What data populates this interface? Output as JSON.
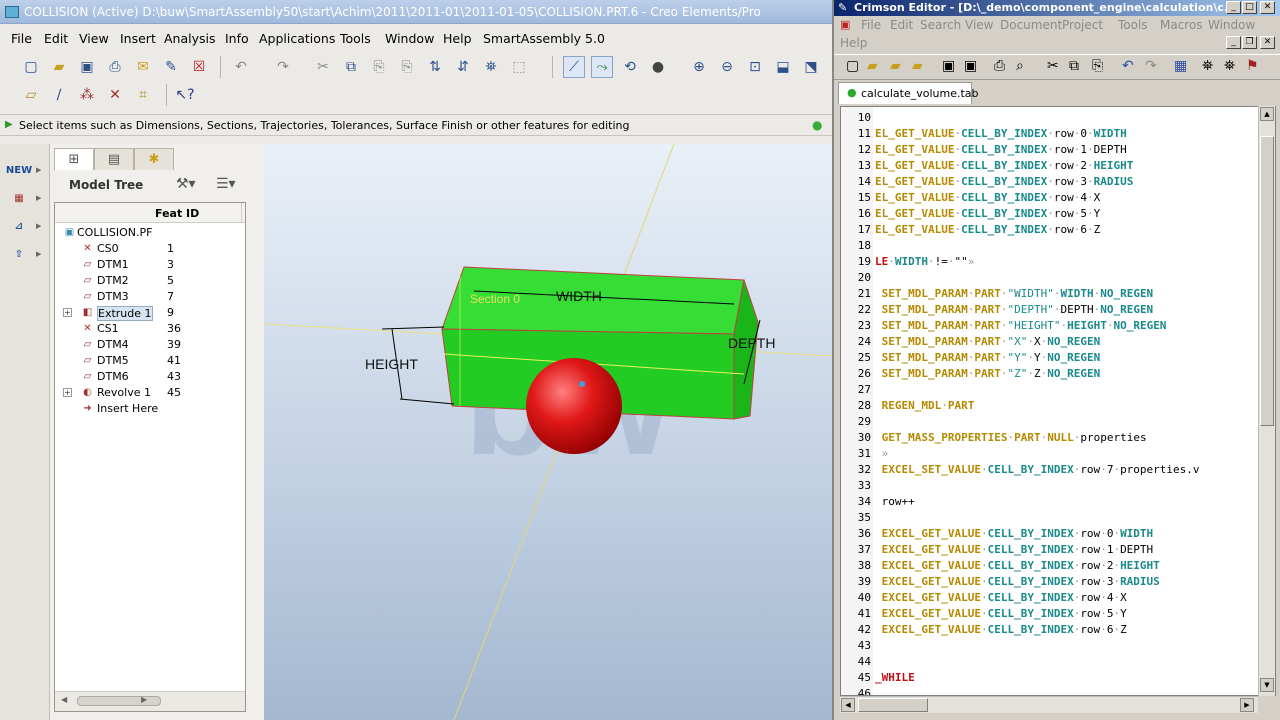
{
  "creo": {
    "title": "COLLISION (Active) D:\\buw\\SmartAssembly50\\start\\Achim\\2011\\2011-01\\2011-01-05\\COLLISION.PRT.6 - Creo Elements/Pro",
    "menu": [
      "File",
      "Edit",
      "View",
      "Insert",
      "Analysis",
      "Info",
      "Applications",
      "Tools",
      "Window",
      "Help",
      "SmartAssembly 5.0"
    ],
    "status_message": "Select items such as Dimensions, Sections, Trajectories, Tolerances, Surface Finish or other features for editing",
    "model_tree_label": "Model Tree",
    "feat_id_header": "Feat ID",
    "tree": [
      {
        "name": "COLLISION.PF",
        "id": "",
        "icon": "part-icon"
      },
      {
        "name": "CS0",
        "id": "1",
        "icon": "csys-icon"
      },
      {
        "name": "DTM1",
        "id": "3",
        "icon": "datum-plane-icon"
      },
      {
        "name": "DTM2",
        "id": "5",
        "icon": "datum-plane-icon"
      },
      {
        "name": "DTM3",
        "id": "7",
        "icon": "datum-plane-icon"
      },
      {
        "name": "Extrude 1",
        "id": "9",
        "icon": "extrude-icon"
      },
      {
        "name": "CS1",
        "id": "36",
        "icon": "csys-icon"
      },
      {
        "name": "DTM4",
        "id": "39",
        "icon": "datum-plane-icon"
      },
      {
        "name": "DTM5",
        "id": "41",
        "icon": "datum-plane-icon"
      },
      {
        "name": "DTM6",
        "id": "43",
        "icon": "datum-plane-icon"
      },
      {
        "name": "Revolve 1",
        "id": "45",
        "icon": "revolve-icon"
      },
      {
        "name": "Insert Here",
        "id": "",
        "icon": "insert-arrow-icon"
      }
    ],
    "dims": {
      "width": "WIDTH",
      "height": "HEIGHT",
      "depth": "DEPTH",
      "section": "Section 0"
    },
    "left_strip_new": "NEW"
  },
  "crimson": {
    "title": "Crimson Editor - [D:\\_demo\\component_engine\\calculation\\c...",
    "menu": [
      "File",
      "Edit",
      "Search",
      "View",
      "Document",
      "Project",
      "Tools",
      "Macros",
      "Window",
      "Help"
    ],
    "tab": "calculate_volume.tab",
    "lines": [
      {
        "n": "10",
        "html": ""
      },
      {
        "n": "11",
        "html": "<span class='kw'>EL_GET_VALUE</span><span class='dot'>·</span><span class='fn'>CELL_BY_INDEX</span><span class='dot'>·</span>row<span class='dot'>·</span>0<span class='dot'>·</span><span class='fn'>WIDTH</span>"
      },
      {
        "n": "12",
        "html": "<span class='kw'>EL_GET_VALUE</span><span class='dot'>·</span><span class='fn'>CELL_BY_INDEX</span><span class='dot'>·</span>row<span class='dot'>·</span>1<span class='dot'>·</span>DEPTH"
      },
      {
        "n": "13",
        "html": "<span class='kw'>EL_GET_VALUE</span><span class='dot'>·</span><span class='fn'>CELL_BY_INDEX</span><span class='dot'>·</span>row<span class='dot'>·</span>2<span class='dot'>·</span><span class='fn'>HEIGHT</span>"
      },
      {
        "n": "14",
        "html": "<span class='kw'>EL_GET_VALUE</span><span class='dot'>·</span><span class='fn'>CELL_BY_INDEX</span><span class='dot'>·</span>row<span class='dot'>·</span>3<span class='dot'>·</span><span class='fn'>RADIUS</span>"
      },
      {
        "n": "15",
        "html": "<span class='kw'>EL_GET_VALUE</span><span class='dot'>·</span><span class='fn'>CELL_BY_INDEX</span><span class='dot'>·</span>row<span class='dot'>·</span>4<span class='dot'>·</span>X"
      },
      {
        "n": "16",
        "html": "<span class='kw'>EL_GET_VALUE</span><span class='dot'>·</span><span class='fn'>CELL_BY_INDEX</span><span class='dot'>·</span>row<span class='dot'>·</span>5<span class='dot'>·</span>Y"
      },
      {
        "n": "17",
        "html": "<span class='kw'>EL_GET_VALUE</span><span class='dot'>·</span><span class='fn'>CELL_BY_INDEX</span><span class='dot'>·</span>row<span class='dot'>·</span>6<span class='dot'>·</span>Z"
      },
      {
        "n": "18",
        "html": ""
      },
      {
        "n": "19",
        "html": "<span class='rd'>LE</span><span class='dot'>·</span><span class='fn'>WIDTH</span><span class='dot'>·</span>!=<span class='dot'>·</span>\"\"<span class='dot'>»</span>"
      },
      {
        "n": "20",
        "html": ""
      },
      {
        "n": "21",
        "html": " <span class='kw'>SET_MDL_PARAM</span><span class='dot'>·</span><span class='kw'>PART</span><span class='dot'>·</span><span class='str'>\"WIDTH\"</span><span class='dot'>·</span><span class='fn'>WIDTH</span><span class='dot'>·</span><span class='fn'>NO_REGEN</span>"
      },
      {
        "n": "22",
        "html": " <span class='kw'>SET_MDL_PARAM</span><span class='dot'>·</span><span class='kw'>PART</span><span class='dot'>·</span><span class='str'>\"DEPTH\"</span><span class='dot'>·</span>DEPTH<span class='dot'>·</span><span class='fn'>NO_REGEN</span>"
      },
      {
        "n": "23",
        "html": " <span class='kw'>SET_MDL_PARAM</span><span class='dot'>·</span><span class='kw'>PART</span><span class='dot'>·</span><span class='str'>\"HEIGHT\"</span><span class='dot'>·</span><span class='fn'>HEIGHT</span><span class='dot'>·</span><span class='fn'>NO_REGEN</span>"
      },
      {
        "n": "24",
        "html": " <span class='kw'>SET_MDL_PARAM</span><span class='dot'>·</span><span class='kw'>PART</span><span class='dot'>·</span><span class='str'>\"X\"</span><span class='dot'>·</span>X<span class='dot'>·</span><span class='fn'>NO_REGEN</span>"
      },
      {
        "n": "25",
        "html": " <span class='kw'>SET_MDL_PARAM</span><span class='dot'>·</span><span class='kw'>PART</span><span class='dot'>·</span><span class='str'>\"Y\"</span><span class='dot'>·</span>Y<span class='dot'>·</span><span class='fn'>NO_REGEN</span>"
      },
      {
        "n": "26",
        "html": " <span class='kw'>SET_MDL_PARAM</span><span class='dot'>·</span><span class='kw'>PART</span><span class='dot'>·</span><span class='str'>\"Z\"</span><span class='dot'>·</span>Z<span class='dot'>·</span><span class='fn'>NO_REGEN</span>"
      },
      {
        "n": "27",
        "html": ""
      },
      {
        "n": "28",
        "html": " <span class='kw'>REGEN_MDL</span><span class='dot'>·</span><span class='kw'>PART</span>"
      },
      {
        "n": "29",
        "html": ""
      },
      {
        "n": "30",
        "html": " <span class='kw'>GET_MASS_PROPERTIES</span><span class='dot'>·</span><span class='kw'>PART</span><span class='dot'>·</span><span class='kw'>NULL</span><span class='dot'>·</span>properties"
      },
      {
        "n": "31",
        "html": " <span class='dot'>»</span>"
      },
      {
        "n": "32",
        "html": " <span class='kw'>EXCEL_SET_VALUE</span><span class='dot'>·</span><span class='fn'>CELL_BY_INDEX</span><span class='dot'>·</span>row<span class='dot'>·</span>7<span class='dot'>·</span>properties.v"
      },
      {
        "n": "33",
        "html": ""
      },
      {
        "n": "34",
        "html": " row++"
      },
      {
        "n": "35",
        "html": ""
      },
      {
        "n": "36",
        "html": " <span class='kw'>EXCEL_GET_VALUE</span><span class='dot'>·</span><span class='fn'>CELL_BY_INDEX</span><span class='dot'>·</span>row<span class='dot'>·</span>0<span class='dot'>·</span><span class='fn'>WIDTH</span>"
      },
      {
        "n": "37",
        "html": " <span class='kw'>EXCEL_GET_VALUE</span><span class='dot'>·</span><span class='fn'>CELL_BY_INDEX</span><span class='dot'>·</span>row<span class='dot'>·</span>1<span class='dot'>·</span>DEPTH"
      },
      {
        "n": "38",
        "html": " <span class='kw'>EXCEL_GET_VALUE</span><span class='dot'>·</span><span class='fn'>CELL_BY_INDEX</span><span class='dot'>·</span>row<span class='dot'>·</span>2<span class='dot'>·</span><span class='fn'>HEIGHT</span>"
      },
      {
        "n": "39",
        "html": " <span class='kw'>EXCEL_GET_VALUE</span><span class='dot'>·</span><span class='fn'>CELL_BY_INDEX</span><span class='dot'>·</span>row<span class='dot'>·</span>3<span class='dot'>·</span><span class='fn'>RADIUS</span>"
      },
      {
        "n": "40",
        "html": " <span class='kw'>EXCEL_GET_VALUE</span><span class='dot'>·</span><span class='fn'>CELL_BY_INDEX</span><span class='dot'>·</span>row<span class='dot'>·</span>4<span class='dot'>·</span>X"
      },
      {
        "n": "41",
        "html": " <span class='kw'>EXCEL_GET_VALUE</span><span class='dot'>·</span><span class='fn'>CELL_BY_INDEX</span><span class='dot'>·</span>row<span class='dot'>·</span>5<span class='dot'>·</span>Y"
      },
      {
        "n": "42",
        "html": " <span class='kw'>EXCEL_GET_VALUE</span><span class='dot'>·</span><span class='fn'>CELL_BY_INDEX</span><span class='dot'>·</span>row<span class='dot'>·</span>6<span class='dot'>·</span>Z"
      },
      {
        "n": "43",
        "html": ""
      },
      {
        "n": "44",
        "html": ""
      },
      {
        "n": "45",
        "html": "<span class='rd'>_WHILE</span>"
      },
      {
        "n": "46",
        "html": ""
      }
    ]
  }
}
